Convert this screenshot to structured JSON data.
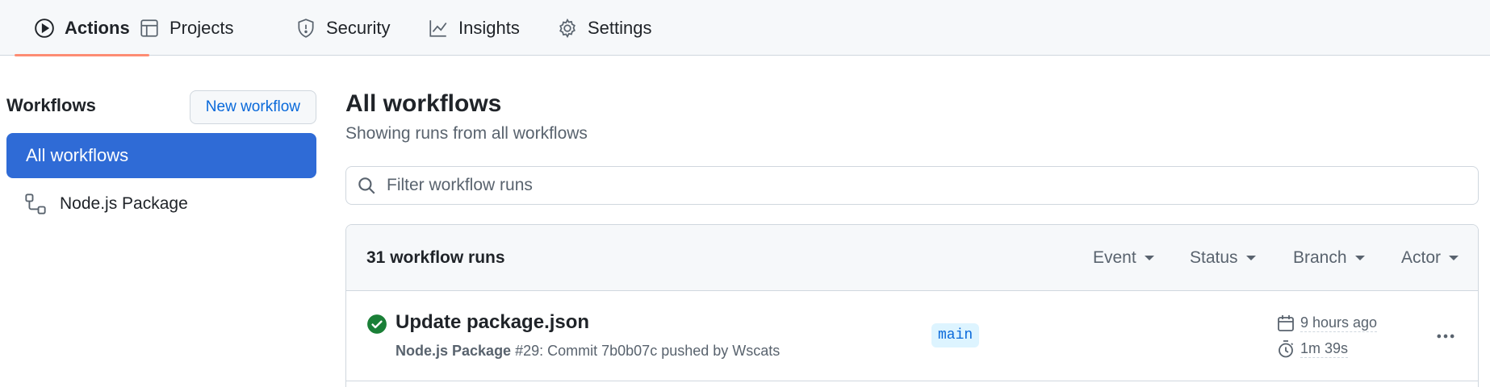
{
  "tabs": [
    {
      "label": "Actions",
      "icon": "play-circle-icon",
      "active": true
    },
    {
      "label": "Projects",
      "icon": "table-icon"
    },
    {
      "label": "Security",
      "icon": "shield-icon"
    },
    {
      "label": "Insights",
      "icon": "graph-icon"
    },
    {
      "label": "Settings",
      "icon": "gear-icon"
    }
  ],
  "sidebar": {
    "title": "Workflows",
    "new_button": "New workflow",
    "items": [
      {
        "label": "All workflows",
        "active": true
      },
      {
        "label": "Node.js Package",
        "icon": "workflow-icon"
      }
    ]
  },
  "main": {
    "title": "All workflows",
    "subtitle": "Showing runs from all workflows",
    "filter_placeholder": "Filter workflow runs",
    "runs_count": "31 workflow runs",
    "filters": [
      "Event",
      "Status",
      "Branch",
      "Actor"
    ],
    "runs": [
      {
        "status": "success",
        "title": "Update package.json",
        "workflow": "Node.js Package",
        "detail": "#29: Commit 7b0b07c pushed by Wscats",
        "branch": "main",
        "time_ago": "9 hours ago",
        "duration": "1m 39s"
      }
    ]
  },
  "colors": {
    "accent": "#2f6bd6",
    "link": "#0969da",
    "success": "#1a7f37",
    "tab_underline": "#fd8c73"
  }
}
